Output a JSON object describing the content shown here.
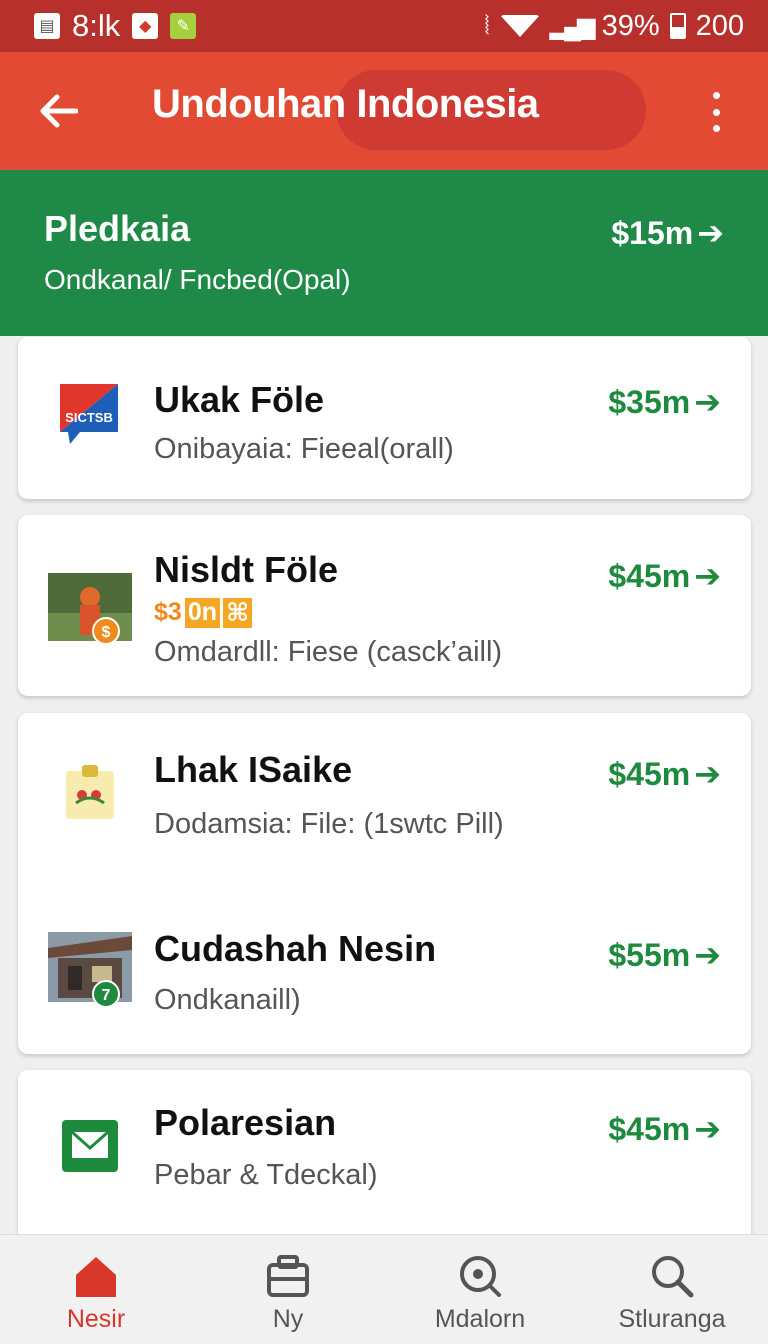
{
  "status_bar": {
    "time": "8:lk",
    "signal_text": "ııı",
    "battery": "39%",
    "clock": "200"
  },
  "app_bar": {
    "title": "Undouhan Indonesia"
  },
  "summary": {
    "title": "Pledkaia",
    "subtitle": "Ondkanal/ Fncbed(Opal)",
    "price": "$15m"
  },
  "items": [
    {
      "title": "Ukak Föle",
      "subtitle": "Onibayaia: Fieeal(orall)",
      "price": "$35m",
      "icon": "sictsb-logo-icon",
      "logo_text": "SICTSB"
    },
    {
      "title": "Nisldt Föle",
      "promo": [
        "$3",
        "0n",
        "⌘"
      ],
      "subtitle": "Omdardll: Fiese (casck’aill)",
      "price": "$45m",
      "icon": "person-photo-thumb"
    },
    {
      "title": "Lhak ISaike",
      "subtitle": "Dodamsia: File: (1swtc Pill)",
      "price": "$45m",
      "icon": "calendar-flower-icon"
    },
    {
      "title": "Cudashah Nesin",
      "subtitle": "Ondkanaill)",
      "price": "$55m",
      "icon": "house-photo-thumb",
      "badge": "7"
    },
    {
      "title": "Polaresian",
      "subtitle": "Pebar & Tdeckal)",
      "price": "$45m",
      "icon": "mail-icon"
    }
  ],
  "bottom_nav": [
    {
      "label": "Nesir",
      "icon": "home-icon",
      "active": true
    },
    {
      "label": "Ny",
      "icon": "briefcase-icon",
      "active": false
    },
    {
      "label": "Mdalorn",
      "icon": "location-icon",
      "active": false
    },
    {
      "label": "Stluranga",
      "icon": "search-icon",
      "active": false
    }
  ],
  "colors": {
    "status_bar": "#b8302c",
    "app_bar": "#e34a33",
    "summary": "#1f8a47",
    "price_green": "#1e8a3e",
    "active_nav": "#d7372b"
  }
}
